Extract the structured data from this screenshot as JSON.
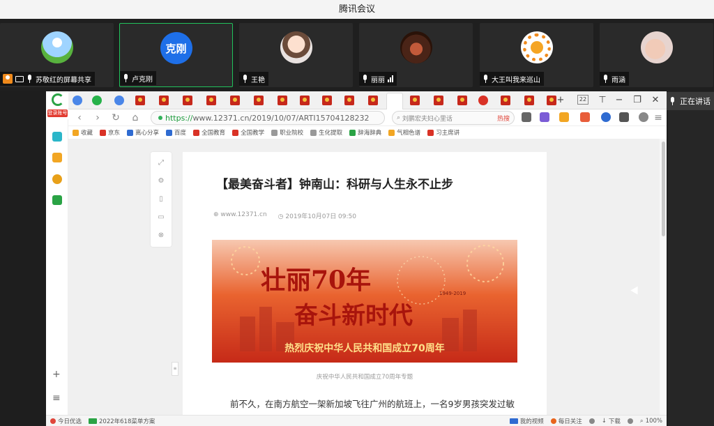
{
  "window_title": "腾讯会议",
  "participants": [
    {
      "name": "苏敬红的屏幕共享",
      "avatar": "landscape-avatar"
    },
    {
      "name": "卢克刚",
      "avatar_text": "克刚"
    },
    {
      "name": "王艳",
      "avatar": "cartoon-girl-avatar"
    },
    {
      "name": "丽丽",
      "avatar": "photo-avatar"
    },
    {
      "name": "大王叫我来巡山",
      "avatar": "orange-flower-avatar"
    },
    {
      "name": "雨涵",
      "avatar": "hand-avatar"
    }
  ],
  "speaking_label": "正在讲话",
  "browser": {
    "login_badge": "登录账号",
    "tab_count": "22",
    "url_scheme": "https://",
    "url_rest": "www.12371.cn/2019/10/07/ARTI15704128232",
    "search_text": "刘鹏宏夫妇心里话",
    "search_hot": "热搜",
    "bookmarks": [
      {
        "label": "收藏",
        "color": "#f2a623"
      },
      {
        "label": "京东",
        "color": "#d93226"
      },
      {
        "label": "离心分享",
        "color": "#2f6bd1"
      },
      {
        "label": "百度",
        "color": "#2f6bd1"
      },
      {
        "label": "全国教育",
        "color": "#d93226"
      },
      {
        "label": "全国教学",
        "color": "#d93226"
      },
      {
        "label": "职业院校",
        "color": "#999999"
      },
      {
        "label": "生化提取",
        "color": "#999999"
      },
      {
        "label": "辞海辞典",
        "color": "#2aa345"
      },
      {
        "label": "气相色谱",
        "color": "#f2a623"
      },
      {
        "label": "习主席讲",
        "color": "#d93226"
      }
    ]
  },
  "article": {
    "title": "【最美奋斗者】钟南山：科研与人生永不止步",
    "source": "www.12371.cn",
    "date": "2019年10月07日 09:50",
    "banner_line1": "壮丽70年",
    "banner_line2": "奋斗新时代",
    "banner_years": "1949-2019",
    "banner_sub": "热烈庆祝中华人民共和国成立70周年",
    "caption": "庆祝中华人民共和国成立70周年专题",
    "paragraph": "前不久，在南方航空一架新加坡飞往广州的航班上，一名9岁男孩突发过敏症状，全身红肿，正当男童家人和空乘人员万分焦急时，一个熟悉身影出现，让大家"
  },
  "status_bar": {
    "left1": "今日优选",
    "left2": "2022年618菜单方案",
    "items": [
      "我的视频",
      "每日关注",
      "下载",
      "100%"
    ]
  }
}
